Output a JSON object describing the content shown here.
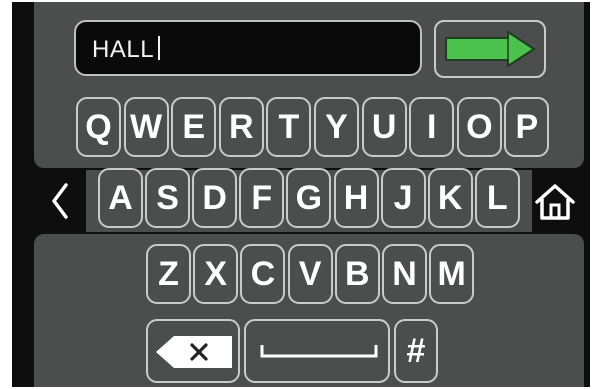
{
  "input": {
    "value": "HALL"
  },
  "icons": {
    "enter": "green-arrow-icon",
    "back": "chevron-left-icon",
    "home": "home-icon",
    "backspace": "backspace-icon",
    "space": "space-bar-icon"
  },
  "colors": {
    "accent_green": "#4cc14e",
    "panel": "#4b4e4d",
    "background": "#0e0e0e"
  },
  "keyboard": {
    "row1": [
      "Q",
      "W",
      "E",
      "R",
      "T",
      "Y",
      "U",
      "I",
      "O",
      "P"
    ],
    "row2": [
      "A",
      "S",
      "D",
      "F",
      "G",
      "H",
      "J",
      "K",
      "L"
    ],
    "row3": [
      "Z",
      "X",
      "C",
      "V",
      "B",
      "N",
      "M"
    ],
    "symbol_key": "#"
  }
}
